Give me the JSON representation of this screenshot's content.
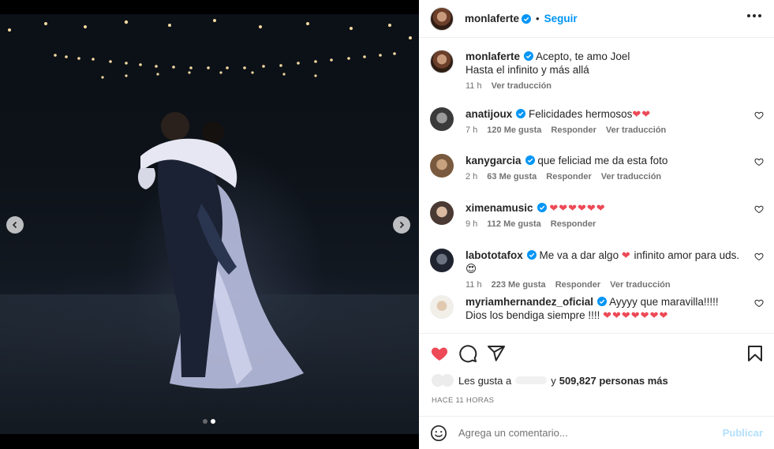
{
  "post": {
    "username": "monlaferte",
    "follow_label": "Seguir",
    "caption_line1": "Acepto, te amo Joel",
    "caption_line2": "Hasta el infinito y más allá",
    "caption_time": "11 h",
    "caption_translate": "Ver traducción"
  },
  "comments": [
    {
      "username": "anatijoux",
      "text": "Felicidades hermosos",
      "hearts": "❤❤",
      "time": "7 h",
      "likes": "120 Me gusta",
      "reply": "Responder",
      "translate": "Ver traducción"
    },
    {
      "username": "kanygarcia",
      "text": "que feliciad me da esta foto",
      "hearts": "",
      "time": "2 h",
      "likes": "63 Me gusta",
      "reply": "Responder",
      "translate": "Ver traducción"
    },
    {
      "username": "ximenamusic",
      "text": "",
      "hearts": "❤❤❤❤❤❤",
      "time": "9 h",
      "likes": "112 Me gusta",
      "reply": "Responder",
      "translate": ""
    },
    {
      "username": "labototafox",
      "text": "Me va a dar algo",
      "hearts": "❤",
      "text2": "infinito amor para uds.",
      "emoji": "😍",
      "time": "11 h",
      "likes": "223 Me gusta",
      "reply": "Responder",
      "translate": "Ver traducción"
    },
    {
      "username": "myriamhernandez_oficial",
      "text": "Ayyyy que maravilla!!!!! Dios los bendiga siempre !!!!",
      "hearts": "❤❤❤❤❤❤❤",
      "time": "",
      "likes": "",
      "reply": "",
      "translate": ""
    }
  ],
  "likes": {
    "prefix": "Les gusta a",
    "connector": "y",
    "count": "509,827 personas más"
  },
  "timestamp": "HACE 11 HORAS",
  "comment_box": {
    "placeholder": "Agrega un comentario...",
    "publish_label": "Publicar"
  },
  "icons": {
    "like": "heart-filled-icon",
    "comment": "comment-icon",
    "share": "share-icon",
    "save": "bookmark-icon",
    "emoji": "emoji-icon",
    "more": "more-options-icon"
  },
  "colors": {
    "accent": "#0095f6",
    "like": "#ed4956",
    "publish_disabled": "#b2dffc",
    "muted": "#737373"
  },
  "carousel": {
    "slide_count": 2,
    "active_index": 1
  }
}
